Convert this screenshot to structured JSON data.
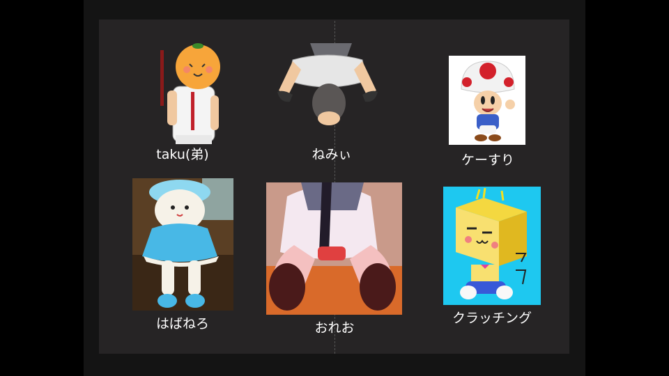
{
  "people": [
    {
      "name": "taku(弟)",
      "icon": "orange-head-boy-icon"
    },
    {
      "name": "ねみぃ",
      "icon": "bowing-person-icon"
    },
    {
      "name": "ケーすり",
      "icon": "mushroom-character-icon"
    },
    {
      "name": "はばねろ",
      "icon": "crochet-doll-icon"
    },
    {
      "name": "おれお",
      "icon": "socks-photo-icon"
    },
    {
      "name": "クラッチング",
      "icon": "yellow-box-character-icon"
    }
  ],
  "colors": {
    "background": "#000000",
    "panel": "#262425",
    "caption": "#ffffff"
  }
}
